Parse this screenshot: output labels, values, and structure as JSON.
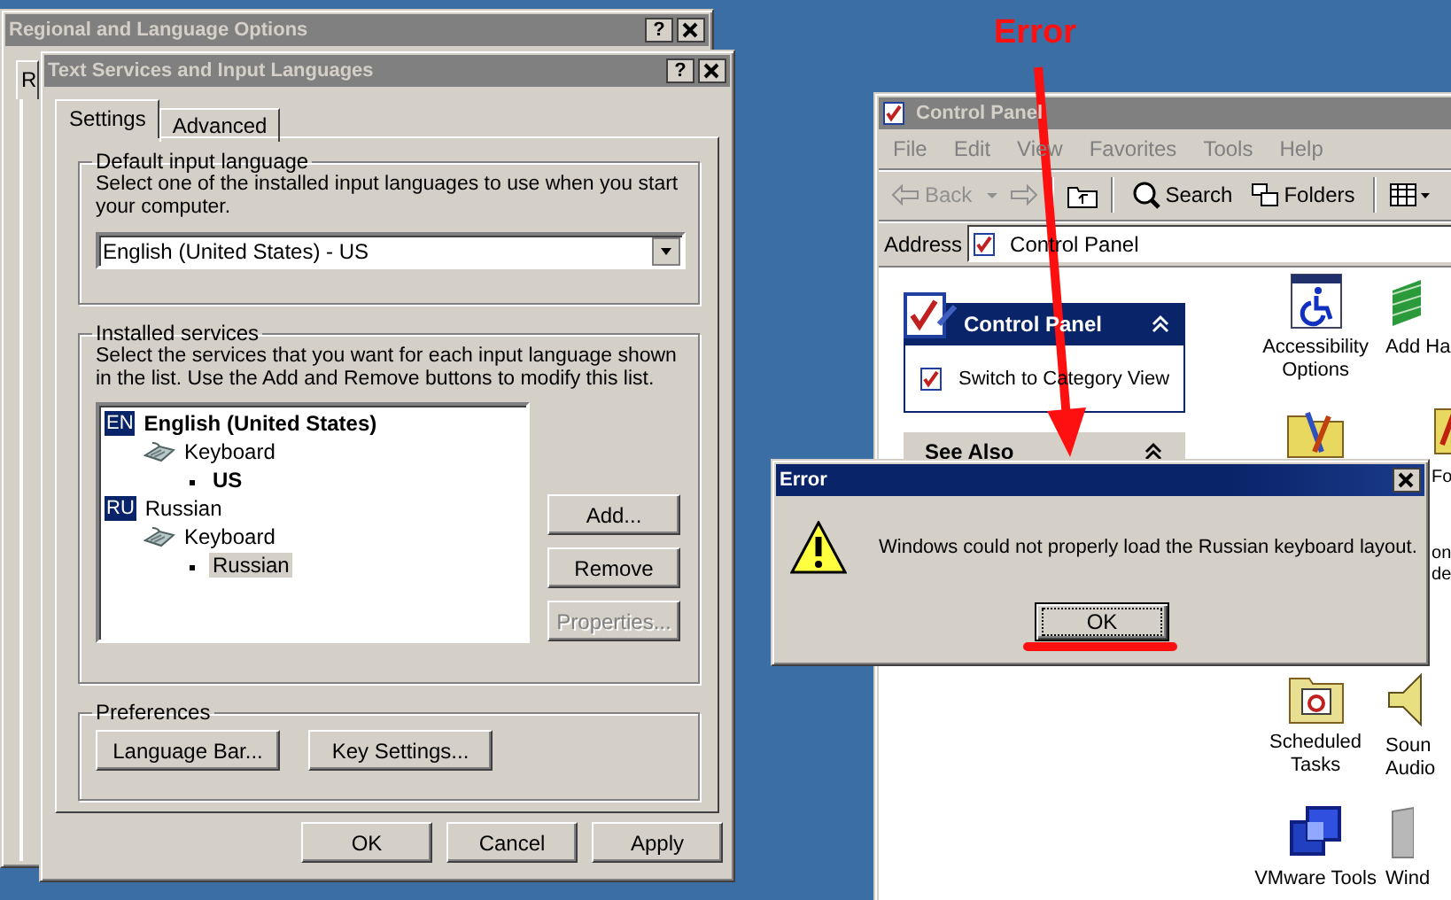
{
  "annotation": {
    "label": "Error"
  },
  "regional_window": {
    "title": "Regional and Language Options",
    "help": "?",
    "tabs": [
      {
        "label": "R",
        "selected": true
      }
    ]
  },
  "text_services_window": {
    "title": "Text Services and Input Languages",
    "help": "?",
    "tabs": [
      {
        "label": "Settings",
        "selected": true
      },
      {
        "label": "Advanced",
        "selected": false
      }
    ],
    "default_language": {
      "heading": "Default input language",
      "description": "Select one of the installed input languages to use when you start your computer.",
      "value": "English (United States) - US"
    },
    "installed_services": {
      "heading": "Installed services",
      "description": "Select the services that you want for each input language shown in the list. Use the Add and Remove buttons to modify this list.",
      "tree": [
        {
          "kind": "language",
          "badge": "EN",
          "label": "English (United States)",
          "default": true,
          "selected": false,
          "children": [
            {
              "kind": "service",
              "label": "Keyboard",
              "default": false,
              "selected": false,
              "children": [
                {
                  "kind": "layout",
                  "label": "US",
                  "default": true,
                  "selected": false
                }
              ]
            }
          ]
        },
        {
          "kind": "language",
          "badge": "RU",
          "label": "Russian",
          "default": false,
          "selected": false,
          "children": [
            {
              "kind": "service",
              "label": "Keyboard",
              "default": false,
              "selected": false,
              "children": [
                {
                  "kind": "layout",
                  "label": "Russian",
                  "default": false,
                  "selected": true
                }
              ]
            }
          ]
        }
      ],
      "buttons": [
        {
          "label": "Add...",
          "disabled": false
        },
        {
          "label": "Remove",
          "disabled": false
        },
        {
          "label": "Properties...",
          "disabled": true
        }
      ]
    },
    "preferences": {
      "heading": "Preferences",
      "buttons": [
        "Language Bar...",
        "Key Settings..."
      ]
    },
    "footer_buttons": [
      "OK",
      "Cancel",
      "Apply"
    ]
  },
  "control_panel_window": {
    "title": "Control Panel",
    "menu": [
      "File",
      "Edit",
      "View",
      "Favorites",
      "Tools",
      "Help"
    ],
    "toolbar": {
      "back": "Back",
      "search": "Search",
      "folders": "Folders"
    },
    "address": {
      "label": "Address",
      "value": "Control Panel"
    },
    "task_pane": {
      "title": "Control Panel",
      "link": "Switch to Category View",
      "see_also": "See Also"
    },
    "icon_rows": [
      [
        {
          "kind": "item",
          "lines": [
            "Accessibility",
            "Options"
          ]
        },
        {
          "kind": "item",
          "lines": [
            "Add Ha"
          ]
        }
      ],
      [
        {
          "kind": "item"
        },
        {
          "kind": "clipped",
          "lines": [
            "Fo"
          ]
        }
      ],
      [
        null,
        {
          "kind": "clipped",
          "lines": [
            "on",
            "de"
          ]
        }
      ],
      [
        {
          "kind": "item",
          "lines": [
            "Scheduled",
            "Tasks"
          ]
        },
        {
          "kind": "item",
          "lines": [
            "Soun",
            "Audio"
          ]
        }
      ],
      [
        {
          "kind": "item",
          "lines": [
            "VMware Tools"
          ]
        },
        {
          "kind": "item",
          "lines": [
            "Wind"
          ]
        }
      ]
    ]
  },
  "error_dialog": {
    "title": "Error",
    "message": "Windows could not properly load the Russian keyboard layout.",
    "button": "OK"
  }
}
